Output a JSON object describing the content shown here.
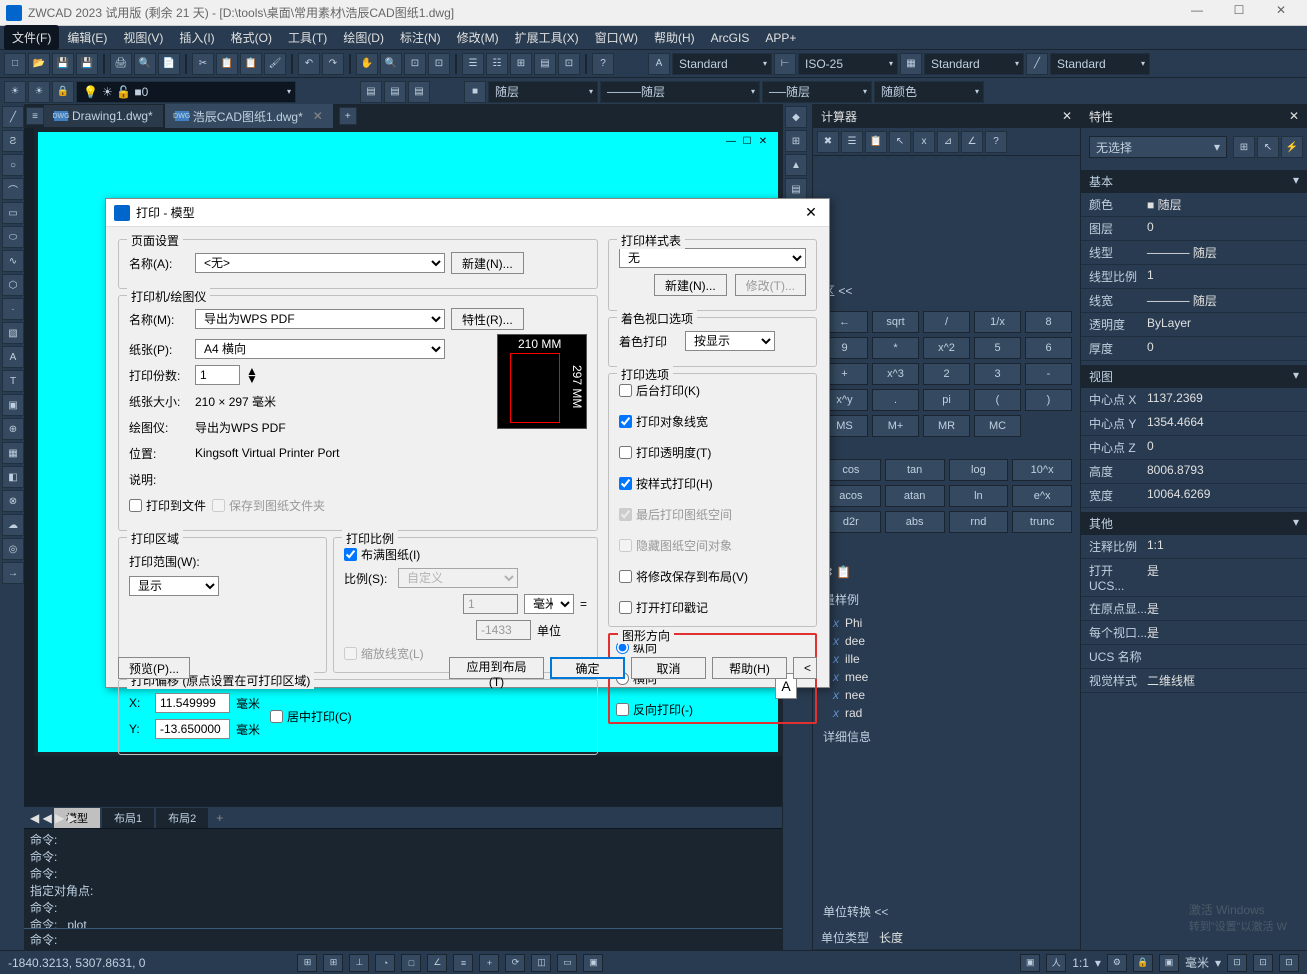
{
  "title": "ZWCAD 2023 试用版 (剩余 21 天) - [D:\\tools\\桌面\\常用素材\\浩辰CAD图纸1.dwg]",
  "menu": [
    "文件(F)",
    "编辑(E)",
    "视图(V)",
    "插入(I)",
    "格式(O)",
    "工具(T)",
    "绘图(D)",
    "标注(N)",
    "修改(M)",
    "扩展工具(X)",
    "窗口(W)",
    "帮助(H)",
    "ArcGIS",
    "APP+"
  ],
  "toolbar2": {
    "layer_value": "0",
    "combo1": "随层",
    "combo2": "随层",
    "combo3": "随层",
    "combo4": "随颜色"
  },
  "styles": {
    "text": "Standard",
    "dim": "ISO-25",
    "table": "Standard",
    "other": "Standard"
  },
  "tabs": [
    {
      "label": "Drawing1.dwg*",
      "active": false
    },
    {
      "label": "浩辰CAD图纸1.dwg*",
      "active": true
    }
  ],
  "print": {
    "title": "打印 - 模型",
    "page_setup": "页面设置",
    "name_label": "名称(A):",
    "name_value": "<无>",
    "new_btn": "新建(N)...",
    "printer_group": "打印机/绘图仪",
    "printer_name_label": "名称(M):",
    "printer_name_value": "导出为WPS PDF",
    "props_btn": "特性(R)...",
    "paper_label": "纸张(P):",
    "paper_value": "A4 横向",
    "copies_label": "打印份数:",
    "copies_value": "1",
    "size_label": "纸张大小:",
    "size_value": "210 × 297  毫米",
    "plotter_label": "绘图仪:",
    "plotter_value": "导出为WPS PDF",
    "location_label": "位置:",
    "location_value": "Kingsoft Virtual Printer Port",
    "desc_label": "说明:",
    "tofile_label": "打印到文件",
    "savepaper_label": "保存到图纸文件夹",
    "area_group": "打印区域",
    "range_label": "打印范围(W):",
    "range_value": "显示",
    "scale_group": "打印比例",
    "fit_label": "布满图纸(I)",
    "ratio_label": "比例(S):",
    "ratio_value": "自定义",
    "mm_value": "1",
    "mm_unit": "毫米",
    "unit_value": "-1433",
    "unit_label": "单位",
    "scale_lw": "缩放线宽(L)",
    "offset_group": "打印偏移 (原点设置在可打印区域)",
    "x_value": "11.549999",
    "y_value": "-13.650000",
    "mm": "毫米",
    "center_label": "居中打印(C)",
    "style_group": "打印样式表",
    "style_value": "无",
    "style_new": "新建(N)...",
    "style_edit": "修改(T)...",
    "shade_group": "着色视口选项",
    "shade_label": "着色打印",
    "shade_value": "按显示",
    "opts_group": "打印选项",
    "opt1": "后台打印(K)",
    "opt2": "打印对象线宽",
    "opt3": "打印透明度(T)",
    "opt4": "按样式打印(H)",
    "opt5": "最后打印图纸空间",
    "opt6": "隐藏图纸空间对象",
    "opt7": "将修改保存到布局(V)",
    "opt8": "打开打印戳记",
    "orient_group": "图形方向",
    "orient1": "纵向",
    "orient2": "横向",
    "orient3": "反向打印(-)",
    "preview_btn": "预览(P)...",
    "apply_btn": "应用到布局(T)",
    "ok_btn": "确定",
    "cancel_btn": "取消",
    "help_btn": "帮助(H)",
    "preview_mm": "210 MM",
    "preview_mm2": "297 MM"
  },
  "calc": {
    "title": "计算器",
    "collapse": "区 <<",
    "keys1": [
      "←",
      "sqrt",
      "/",
      "1/x",
      "8",
      "9",
      "*",
      "x^2",
      "5",
      "6",
      "+",
      "x^3",
      "2",
      "3",
      "-",
      "x^y",
      ".",
      "pi",
      "(",
      ")",
      "MS",
      "M+",
      "MR",
      "MC"
    ],
    "keys2": [
      "cos",
      "tan",
      "log",
      "10^x",
      "acos",
      "atan",
      "ln",
      "e^x",
      "d2r",
      "abs",
      "rnd",
      "trunc"
    ],
    "vars_title": "量样例",
    "vars": [
      "Phi",
      "dee",
      "ille",
      "mee",
      "nee",
      "rad"
    ],
    "detail": "详细信息",
    "unit_conv": "单位转换 <<",
    "unit_type": "单位类型",
    "unit_val": "长度"
  },
  "props": {
    "title": "特性",
    "sel": "无选择",
    "sec_basic": "基本",
    "rows_basic": [
      [
        "颜色",
        "■ 随层"
      ],
      [
        "图层",
        "0"
      ],
      [
        "线型",
        "───── 随层"
      ],
      [
        "线型比例",
        "1"
      ],
      [
        "线宽",
        "───── 随层"
      ],
      [
        "透明度",
        "ByLayer"
      ],
      [
        "厚度",
        "0"
      ]
    ],
    "sec_view": "视图",
    "rows_view": [
      [
        "中心点 X",
        "1137.2369"
      ],
      [
        "中心点 Y",
        "1354.4664"
      ],
      [
        "中心点 Z",
        "0"
      ],
      [
        "高度",
        "8006.8793"
      ],
      [
        "宽度",
        "10064.6269"
      ]
    ],
    "sec_other": "其他",
    "rows_other": [
      [
        "注释比例",
        "1:1"
      ],
      [
        "打开 UCS...",
        "是"
      ],
      [
        "在原点显...",
        "是"
      ],
      [
        "每个视口...",
        "是"
      ],
      [
        "UCS 名称",
        ""
      ],
      [
        "视觉样式",
        "二维线框"
      ]
    ]
  },
  "bottom_tabs": [
    "模型",
    "布局1",
    "布局2"
  ],
  "cmdlines": [
    "命令:",
    "命令:",
    "命令:",
    "指定对角点:",
    "命令:",
    "命令: _plot"
  ],
  "cmd_prompt": "命令:",
  "status": {
    "coords": "-1840.3213, 5307.8631, 0",
    "mm": "毫米",
    "scale": "1:1"
  },
  "watermark": "激活 Windows",
  "watermark2": "转到\"设置\"以激活 W"
}
